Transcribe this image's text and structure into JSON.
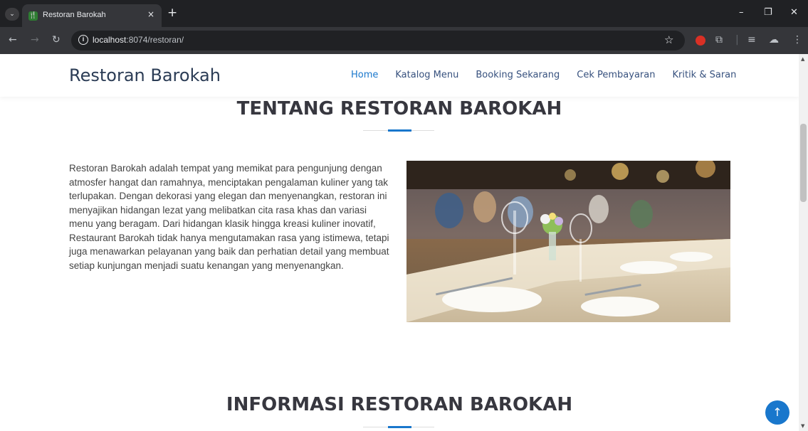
{
  "browser": {
    "tab_title": "Restoran Barokah",
    "tab_close": "×",
    "new_tab": "+",
    "url_host": "localhost",
    "url_path": ":8074/restoran/",
    "info_glyph": "i",
    "minimize": "–",
    "restore": "❐",
    "close": "✕"
  },
  "site": {
    "brand": "Restoran Barokah",
    "nav": [
      {
        "label": "Home",
        "active": true
      },
      {
        "label": "Katalog Menu"
      },
      {
        "label": "Booking Sekarang"
      },
      {
        "label": "Cek Pembayaran"
      },
      {
        "label": "Kritik & Saran"
      }
    ]
  },
  "about": {
    "title": "TENTANG RESTORAN BAROKAH",
    "body": "Restoran Barokah adalah tempat yang memikat para pengunjung dengan atmosfer hangat dan ramahnya, menciptakan pengalaman kuliner yang tak terlupakan. Dengan dekorasi yang elegan dan menyenangkan, restoran ini menyajikan hidangan lezat yang melibatkan cita rasa khas dan variasi menu yang beragam. Dari hidangan klasik hingga kreasi kuliner inovatif, Restaurant Barokah tidak hanya mengutamakan rasa yang istimewa, tetapi juga menawarkan pelayanan yang baik dan perhatian detail yang membuat setiap kunjungan menjadi suatu kenangan yang menyenangkan."
  },
  "info": {
    "title": "INFORMASI RESTORAN BAROKAH"
  },
  "colors": {
    "accent": "#1977cc",
    "brand_text": "#2b3c55",
    "heading": "#37373f"
  }
}
